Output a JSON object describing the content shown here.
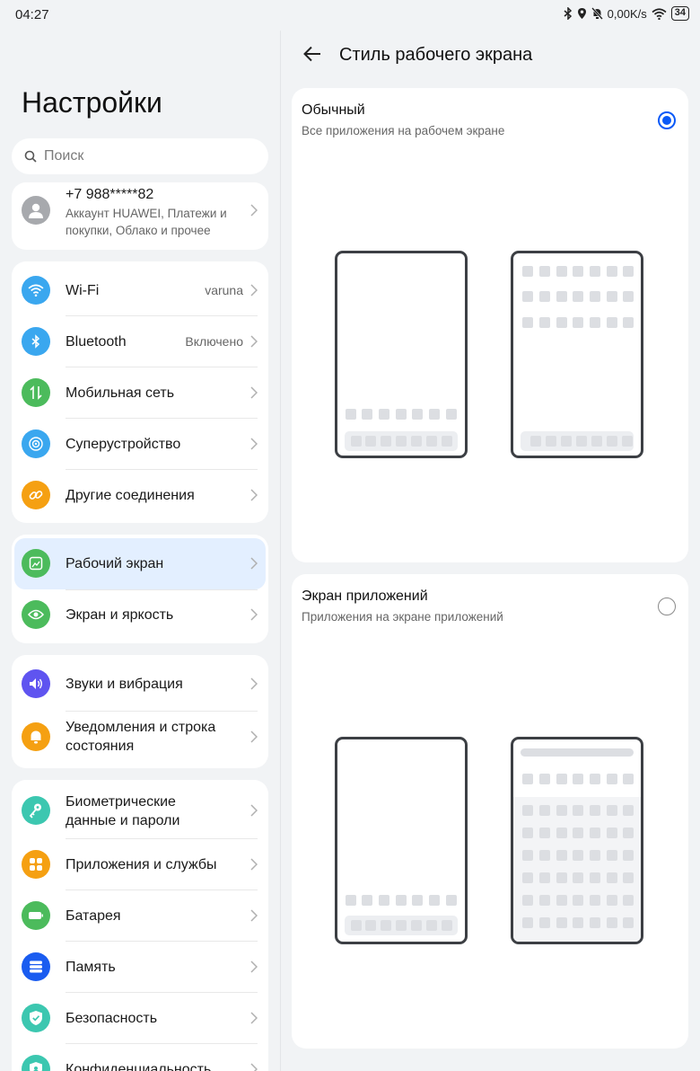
{
  "status": {
    "time": "04:27",
    "speed": "0,00K/s",
    "battery": "34",
    "icons": [
      "bluetooth-icon",
      "location-icon",
      "mute-bell-icon",
      "wifi-icon",
      "battery-icon"
    ]
  },
  "left": {
    "title": "Настройки",
    "search_placeholder": "Поиск",
    "account": {
      "phone": "+7 988*****82",
      "desc_line1": "Аккаунт HUAWEI, Платежи и",
      "desc_line2": "покупки, Облако и прочее"
    },
    "group1": [
      {
        "label": "Wi-Fi",
        "value": "varuna",
        "icon": "wifi-icon",
        "color": "#3aa7ef"
      },
      {
        "label": "Bluetooth",
        "value": "Включено",
        "icon": "bluetooth-icon",
        "color": "#3aa7ef"
      },
      {
        "label": "Мобильная сеть",
        "value": "",
        "icon": "mobile-data-icon",
        "color": "#4cbb5c"
      },
      {
        "label": "Суперустройство",
        "value": "",
        "icon": "super-device-icon",
        "color": "#3aa7ef"
      },
      {
        "label": "Другие соединения",
        "value": "",
        "icon": "link-icon",
        "color": "#f5a012"
      }
    ],
    "group2": [
      {
        "label": "Рабочий экран",
        "icon": "home-screen-icon",
        "color": "#4cbb5c"
      },
      {
        "label": "Экран и яркость",
        "icon": "eye-icon",
        "color": "#4cbb5c"
      }
    ],
    "group3": [
      {
        "label": "Звуки и вибрация",
        "icon": "sound-icon",
        "color": "#5f54f0"
      },
      {
        "label_line1": "Уведомления и строка",
        "label_line2": "состояния",
        "icon": "bell-icon",
        "color": "#f5a012"
      }
    ],
    "group4": [
      {
        "label_line1": "Биометрические",
        "label_line2": "данные и пароли",
        "icon": "key-icon",
        "color": "#3cc7b0"
      },
      {
        "label": "Приложения и службы",
        "icon": "apps-icon",
        "color": "#f5a012"
      },
      {
        "label": "Батарея",
        "icon": "battery-icon",
        "color": "#4cbb5c"
      },
      {
        "label": "Память",
        "icon": "storage-icon",
        "color": "#1a5cf0"
      },
      {
        "label": "Безопасность",
        "icon": "shield-icon",
        "color": "#3cc7b0"
      },
      {
        "label": "Конфиденциальность",
        "icon": "privacy-icon",
        "color": "#3cc7b0"
      }
    ]
  },
  "right": {
    "title": "Стиль рабочего экрана",
    "options": [
      {
        "title": "Обычный",
        "subtitle": "Все приложения на рабочем экране",
        "selected": true
      },
      {
        "title": "Экран приложений",
        "subtitle": "Приложения на экране приложений",
        "selected": false
      }
    ]
  },
  "colors": {
    "accent": "#0a59f7",
    "active_row": "#e3efff"
  }
}
